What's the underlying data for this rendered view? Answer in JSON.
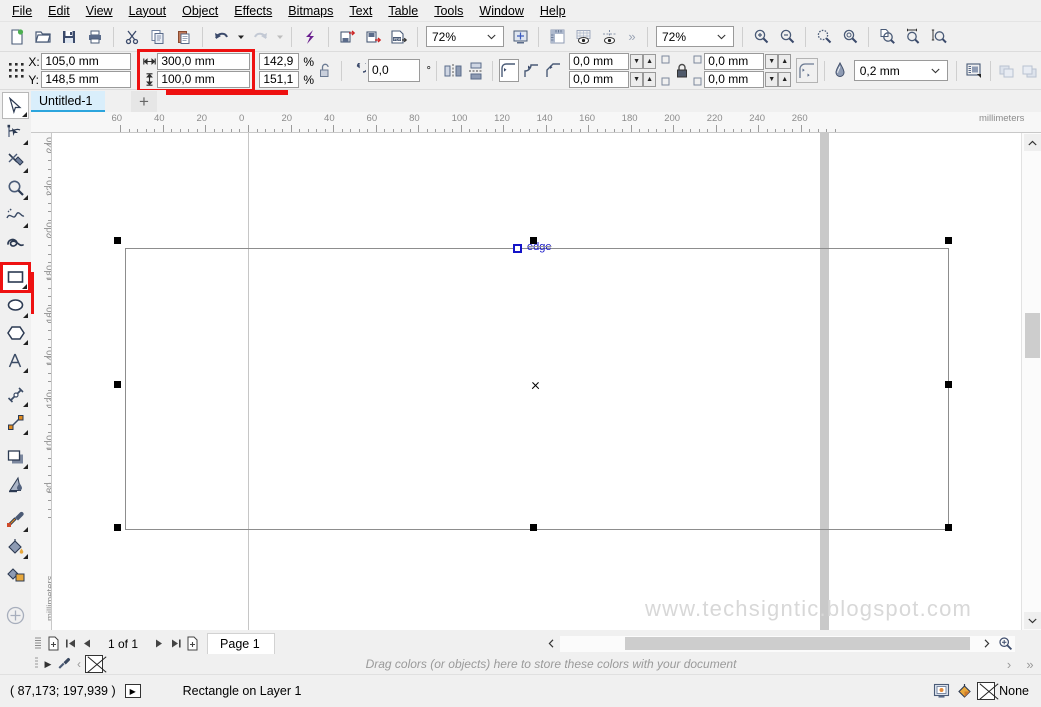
{
  "menu": {
    "items": [
      {
        "label": "File"
      },
      {
        "label": "Edit"
      },
      {
        "label": "View"
      },
      {
        "label": "Layout"
      },
      {
        "label": "Object"
      },
      {
        "label": "Effects"
      },
      {
        "label": "Bitmaps"
      },
      {
        "label": "Text"
      },
      {
        "label": "Table"
      },
      {
        "label": "Tools"
      },
      {
        "label": "Window"
      },
      {
        "label": "Help"
      }
    ]
  },
  "standard_toolbar": {
    "buttons": [
      {
        "name": "new-document-icon"
      },
      {
        "name": "open-document-icon"
      },
      {
        "name": "save-icon"
      },
      {
        "name": "print-icon"
      },
      {
        "name": "cut-icon"
      },
      {
        "name": "copy-icon"
      },
      {
        "name": "paste-icon"
      },
      {
        "name": "undo-icon"
      },
      {
        "name": "undo-dropdown-icon"
      },
      {
        "name": "redo-icon"
      },
      {
        "name": "redo-dropdown-icon"
      },
      {
        "name": "corel-connect-icon"
      },
      {
        "name": "import-icon"
      },
      {
        "name": "export-icon"
      },
      {
        "name": "publish-pdf-icon"
      }
    ],
    "zoom_level": "72%",
    "zoom_level_secondary": "72%",
    "full_screen_preview_label": "full-screen-preview-icon",
    "show_rulers_icon": "show-rulers-icon",
    "show_grid_icon": "show-grid-icon",
    "show_guidelines_icon": "show-guidelines-icon",
    "overflow_label": "»",
    "zoom_tools": [
      {
        "name": "zoom-in-icon"
      },
      {
        "name": "zoom-out-icon"
      },
      {
        "name": "zoom-all-objects-icon"
      },
      {
        "name": "zoom-selection-icon"
      },
      {
        "name": "zoom-to-page-icon"
      },
      {
        "name": "zoom-page-width-icon"
      },
      {
        "name": "zoom-page-height-icon"
      }
    ]
  },
  "property_bar": {
    "object_position_icon": "object-origin-icon",
    "x_label": "X:",
    "x_value": "105,0 mm",
    "y_label": "Y:",
    "y_value": "148,5 mm",
    "width_value": "300,0 mm",
    "height_value": "100,0 mm",
    "scale_width_pct": "142,9",
    "scale_height_pct": "151,1",
    "percent_symbol": "%",
    "lock_ratio_icon": "unlock-ratio-icon",
    "rotation_icon": "rotation-angle-icon",
    "rotation_value": "0,0",
    "degree_symbol": "°",
    "mirror_horizontal_icon": "mirror-horizontal-icon",
    "mirror_vertical_icon": "mirror-vertical-icon",
    "corner_round_icon": "round-corner-icon",
    "corner_scallop_icon": "scalloped-corner-icon",
    "corner_chamfer_icon": "chamfered-corner-icon",
    "corner_radius_tl": "0,0 mm",
    "corner_radius_bl": "0,0 mm",
    "corner_radius_tr": "0,0 mm",
    "corner_radius_br": "0,0 mm",
    "corner_lock_icon": "lock-corner-radius-icon",
    "relative_corner_icon": "relative-corner-scaling-icon",
    "outline_width_icon": "outline-width-icon",
    "outline_width_value": "0,2 mm",
    "text_wrap_icon": "wrap-paragraph-text-icon",
    "to_front_icon": "to-front-of-layer-icon",
    "to_back_icon": "to-back-of-layer-icon"
  },
  "document_tabs": {
    "active_tab": "Untitled-1",
    "new_tab_label": "+"
  },
  "toolbox": {
    "tools": [
      {
        "name": "pick-tool",
        "icon": "arrow-cursor-icon",
        "active": true,
        "flyout": true
      },
      {
        "name": "shape-tool",
        "icon": "node-edit-icon",
        "active": false,
        "flyout": true
      },
      {
        "name": "crop-tool",
        "icon": "crop-icon",
        "active": false,
        "flyout": true
      },
      {
        "name": "zoom-tool",
        "icon": "magnifier-icon",
        "active": false,
        "flyout": true
      },
      {
        "name": "freehand-tool",
        "icon": "freehand-curve-icon",
        "active": false,
        "flyout": true
      },
      {
        "name": "artistic-media-tool",
        "icon": "artistic-media-icon",
        "active": false,
        "flyout": false
      },
      {
        "name": "rectangle-tool",
        "icon": "rectangle-icon",
        "active": false,
        "flyout": true,
        "selected": true
      },
      {
        "name": "ellipse-tool",
        "icon": "ellipse-icon",
        "active": false,
        "flyout": true
      },
      {
        "name": "polygon-tool",
        "icon": "polygon-icon",
        "active": false,
        "flyout": true
      },
      {
        "name": "text-tool",
        "icon": "text-a-icon",
        "active": false,
        "flyout": true
      },
      {
        "name": "parallel-dimension-tool",
        "icon": "dimension-line-icon",
        "active": false,
        "flyout": true
      },
      {
        "name": "straight-line-connector-tool",
        "icon": "connector-line-icon",
        "active": false,
        "flyout": true
      },
      {
        "name": "drop-shadow-tool",
        "icon": "drop-shadow-icon",
        "active": false,
        "flyout": true
      },
      {
        "name": "transparency-tool",
        "icon": "transparency-icon",
        "active": false,
        "flyout": false
      },
      {
        "name": "color-eyedropper-tool",
        "icon": "eyedropper-icon",
        "active": false,
        "flyout": true
      },
      {
        "name": "interactive-fill-tool",
        "icon": "fill-bucket-icon",
        "active": false,
        "flyout": true
      },
      {
        "name": "smart-fill-tool",
        "icon": "smart-fill-icon",
        "active": false,
        "flyout": false
      },
      {
        "name": "quick-customize",
        "icon": "plus-circle-icon",
        "active": false,
        "flyout": false
      }
    ]
  },
  "rulers": {
    "unit_label": "millimeters",
    "horizontal_ticks": [
      "60",
      "40",
      "20",
      "0",
      "20",
      "40",
      "60",
      "80",
      "100",
      "120",
      "140",
      "160",
      "180",
      "200",
      "220",
      "240",
      "260"
    ],
    "vertical_ticks": [
      "240",
      "220",
      "200",
      "180",
      "160",
      "140",
      "120",
      "100",
      "80"
    ],
    "vertical_unit_label": "millimeters"
  },
  "canvas": {
    "snap_label": "edge",
    "watermark": "www.techsigntic.blogspot.com"
  },
  "page_nav": {
    "add_page_start_icon": "add-page-before-icon",
    "first_page_icon": "◀|",
    "prev_page_icon": "◀",
    "page_counter": "1 of 1",
    "next_page_icon": "▶",
    "last_page_icon": "|▶",
    "add_page_end_icon": "add-page-after-icon",
    "page_tab_label": "Page 1"
  },
  "palette_bar": {
    "expand_icon": "▶",
    "eyedropper_icon": "color-eyedropper-icon",
    "scroll_up_icon": "‹",
    "no_color_swatch": "no-color-swatch-icon",
    "hint_text": "Drag colors (or objects) here to store these colors with your document",
    "scroll_down_icon": "›",
    "expand_palette_icon": "»"
  },
  "status_bar": {
    "coordinates": "( 87,173; 197,939 )",
    "play_icon": "▶",
    "object_info": "Rectangle on Layer 1",
    "screen_icon": "color-proof-icon",
    "fill_icon": "fill-color-icon",
    "outline_value": "None"
  },
  "colors": {
    "accent_red": "#ee1111",
    "tab_blue": "#2ca5dd",
    "snap_blue": "#1414c8",
    "ui_bg": "#f0f0f0",
    "canvas_bg": "#ffffff",
    "watermark_gray": "#d8d8d8"
  }
}
